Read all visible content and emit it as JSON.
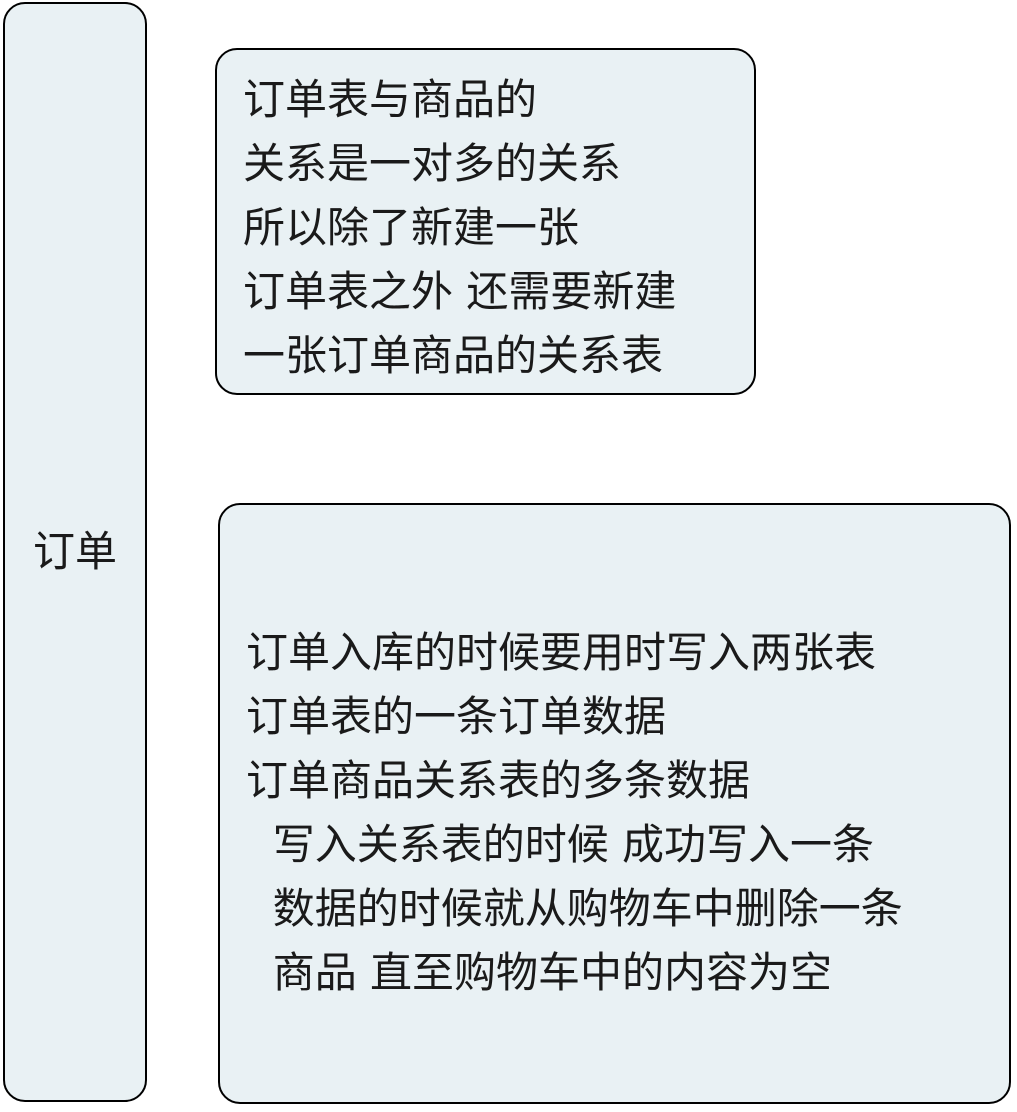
{
  "colors": {
    "node_fill": "#e9f1f4",
    "node_border": "#000000",
    "text": "#1a1a1a",
    "background": "#ffffff"
  },
  "root": {
    "label": "订单"
  },
  "notes": [
    {
      "lines": [
        "订单表与商品的",
        "关系是一对多的关系",
        "所以除了新建一张",
        "订单表之外 还需要新建",
        "一张订单商品的关系表"
      ]
    },
    {
      "lines": [
        "订单入库的时候要用时写入两张表",
        "订单表的一条订单数据",
        "订单商品关系表的多条数据",
        "  写入关系表的时候 成功写入一条",
        "  数据的时候就从购物车中删除一条",
        "  商品 直至购物车中的内容为空"
      ]
    }
  ]
}
